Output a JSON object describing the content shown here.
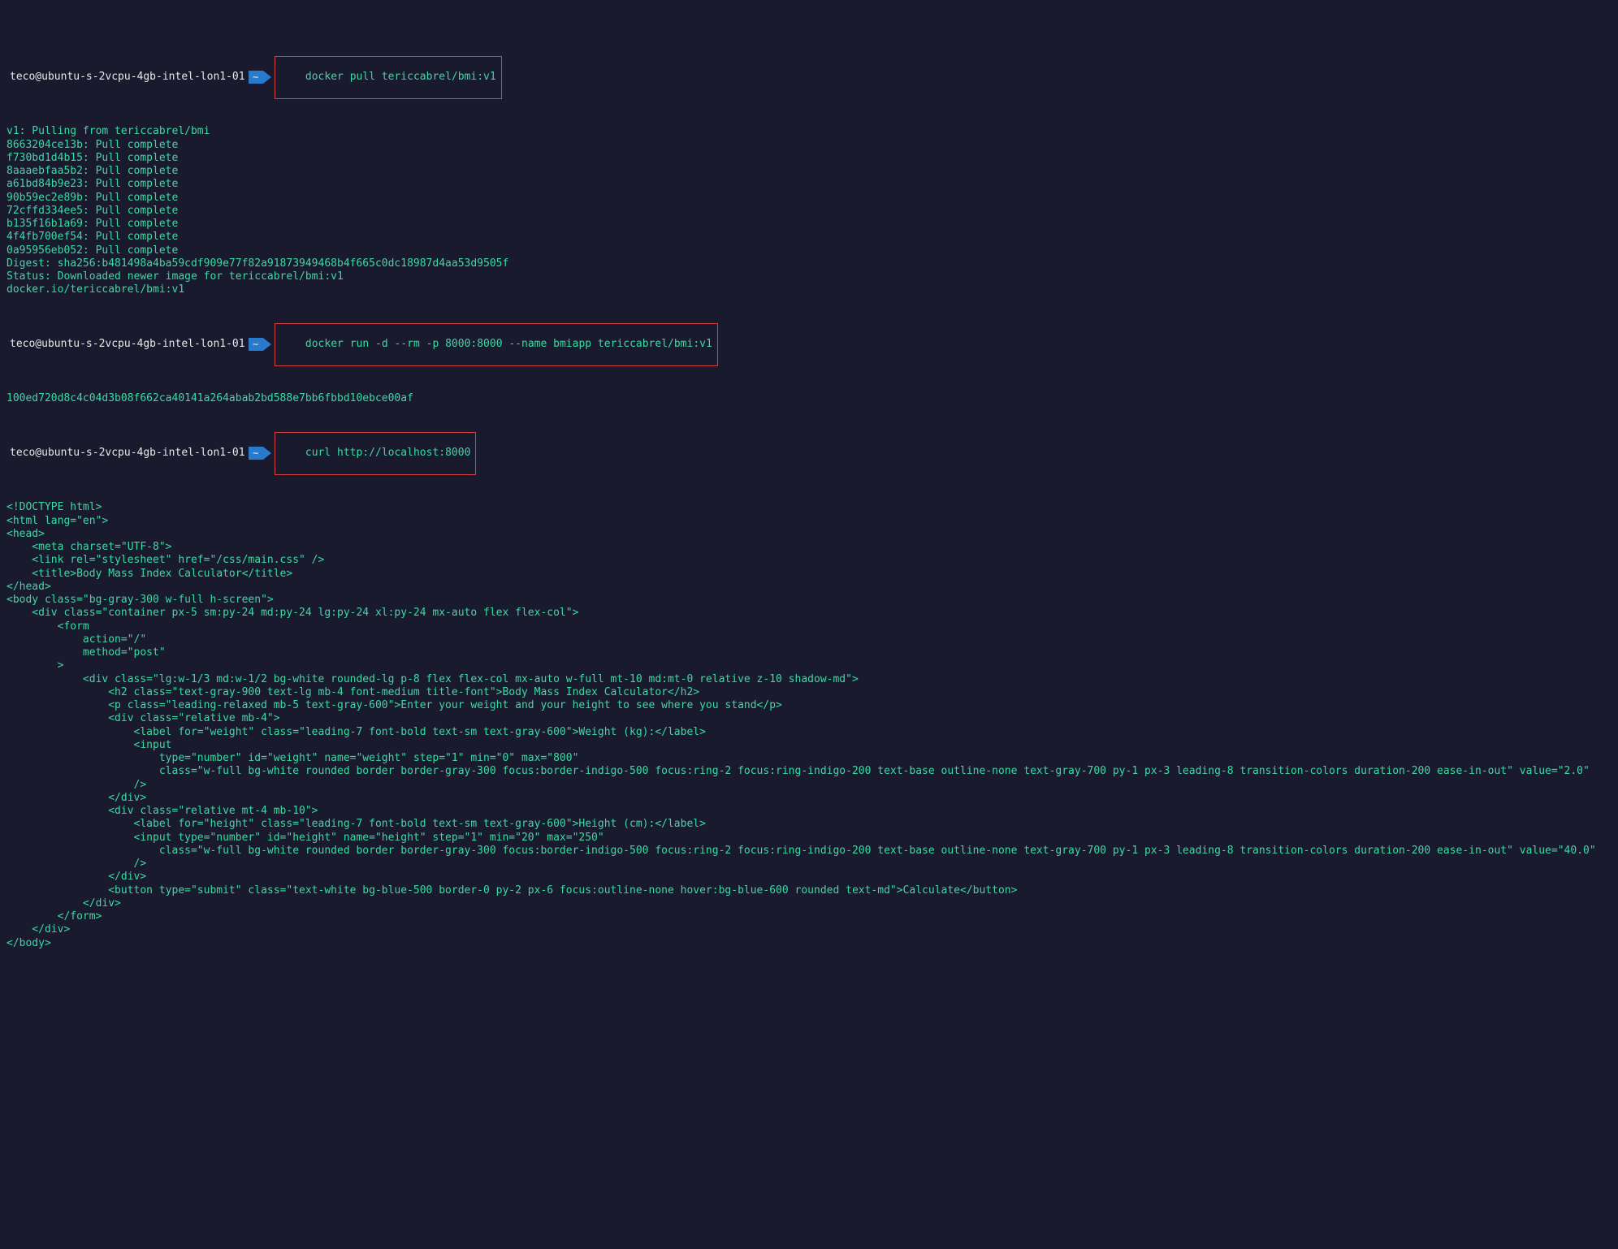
{
  "prompt1": {
    "user": "teco@ubuntu-s-2vcpu-4gb-intel-lon1-01",
    "tilde": "~",
    "command": "docker pull tericcabrel/bmi:v1"
  },
  "output1": [
    "v1: Pulling from tericcabrel/bmi",
    "8663204ce13b: Pull complete",
    "f730bd1d4b15: Pull complete",
    "8aaaebfaa5b2: Pull complete",
    "a61bd84b9e23: Pull complete",
    "90b59ec2e89b: Pull complete",
    "72cffd334ee5: Pull complete",
    "b135f16b1a69: Pull complete",
    "4f4fb700ef54: Pull complete",
    "0a95956eb052: Pull complete",
    "Digest: sha256:b481498a4ba59cdf909e77f82a91873949468b4f665c0dc18987d4aa53d9505f",
    "Status: Downloaded newer image for tericcabrel/bmi:v1",
    "docker.io/tericcabrel/bmi:v1"
  ],
  "prompt2": {
    "user": "teco@ubuntu-s-2vcpu-4gb-intel-lon1-01",
    "tilde": "~",
    "command": "docker run -d --rm -p 8000:8000 --name bmiapp tericcabrel/bmi:v1"
  },
  "output2": [
    "100ed720d8c4c04d3b08f662ca40141a264abab2bd588e7bb6fbbd10ebce00af"
  ],
  "prompt3": {
    "user": "teco@ubuntu-s-2vcpu-4gb-intel-lon1-01",
    "tilde": "~",
    "command": "curl http://localhost:8000"
  },
  "output3": [
    "<!DOCTYPE html>",
    "<html lang=\"en\">",
    "<head>",
    "    <meta charset=\"UTF-8\">",
    "    <link rel=\"stylesheet\" href=\"/css/main.css\" />",
    "    <title>Body Mass Index Calculator</title>",
    "</head>",
    "<body class=\"bg-gray-300 w-full h-screen\">",
    "    <div class=\"container px-5 sm:py-24 md:py-24 lg:py-24 xl:py-24 mx-auto flex flex-col\">",
    "",
    "        <form",
    "            action=\"/\"",
    "            method=\"post\"",
    "        >",
    "            <div class=\"lg:w-1/3 md:w-1/2 bg-white rounded-lg p-8 flex flex-col mx-auto w-full mt-10 md:mt-0 relative z-10 shadow-md\">",
    "                <h2 class=\"text-gray-900 text-lg mb-4 font-medium title-font\">Body Mass Index Calculator</h2>",
    "                <p class=\"leading-relaxed mb-5 text-gray-600\">Enter your weight and your height to see where you stand</p>",
    "",
    "                <div class=\"relative mb-4\">",
    "                    <label for=\"weight\" class=\"leading-7 font-bold text-sm text-gray-600\">Weight (kg):</label>",
    "                    <input",
    "                        type=\"number\" id=\"weight\" name=\"weight\" step=\"1\" min=\"0\" max=\"800\"",
    "                        class=\"w-full bg-white rounded border border-gray-300 focus:border-indigo-500 focus:ring-2 focus:ring-indigo-200 text-base outline-none text-gray-700 py-1 px-3 leading-8 transition-colors duration-200 ease-in-out\" value=\"2.0\"",
    "                    />",
    "",
    "                </div>",
    "                <div class=\"relative mt-4 mb-10\">",
    "                    <label for=\"height\" class=\"leading-7 font-bold text-sm text-gray-600\">Height (cm):</label>",
    "                    <input type=\"number\" id=\"height\" name=\"height\" step=\"1\" min=\"20\" max=\"250\"",
    "                        class=\"w-full bg-white rounded border border-gray-300 focus:border-indigo-500 focus:ring-2 focus:ring-indigo-200 text-base outline-none text-gray-700 py-1 px-3 leading-8 transition-colors duration-200 ease-in-out\" value=\"40.0\"",
    "                    />",
    "",
    "",
    "                </div>",
    "",
    "                <button type=\"submit\" class=\"text-white bg-blue-500 border-0 py-2 px-6 focus:outline-none hover:bg-blue-600 rounded text-md\">Calculate</button>",
    "            </div>",
    "        </form>",
    "    </div>",
    "</body>"
  ]
}
